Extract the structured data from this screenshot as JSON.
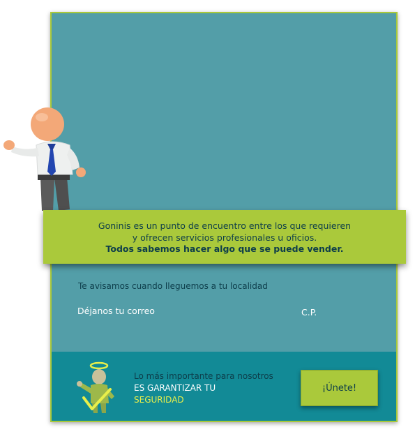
{
  "banner": {
    "line1": "Goninis es un punto de encuentro entre los que requieren",
    "line2": "y ofrecen servicios  profesionales u oficios.",
    "line3": "Todos sabemos hacer algo que se puede vender."
  },
  "form": {
    "notice": "Te avisamos cuando lleguemos a tu localidad",
    "email_label": "Déjanos tu correo",
    "cp_label": "C.P."
  },
  "footer": {
    "line1": "Lo más importante para nosotros",
    "line2": "ES GARANTIZAR TU",
    "line3": "SEGURIDAD",
    "join_label": "¡Únete!"
  },
  "colors": {
    "panel": "#539ea8",
    "accent": "#aac93b",
    "footer": "#128a96",
    "highlight": "#e8ef4a"
  }
}
